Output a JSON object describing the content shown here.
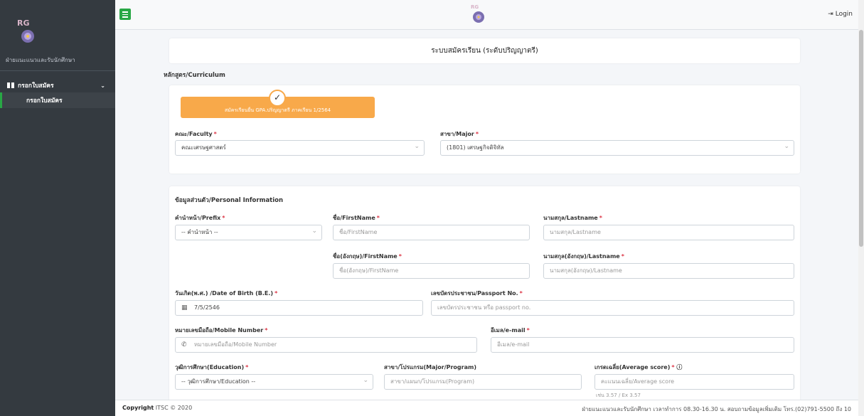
{
  "sidebar": {
    "brand_text": "ฝ่ายแนะแนวและรับนักศึกษา",
    "logo_text": "RG",
    "menu_group": "กรอกใบสมัคร",
    "menu_item": "กรอกใบสมัคร"
  },
  "topbar": {
    "login_label": "Login",
    "logo_text": "RG"
  },
  "page": {
    "title": "ระบบสมัครเรียน (ระดับปริญญาตรี)"
  },
  "curriculum": {
    "section_label": "หลักสูตร/Curriculum",
    "round_badge": "สมัครเรียนยื่น GPA.ปริญญาตรี ภาคเรียน 1/2564",
    "faculty_label": "คณะ/Faculty",
    "faculty_value": "คณะเศรษฐศาสตร์",
    "major_label": "สาขา/Major",
    "major_value": "(1801) เศรษฐกิจดิจิทัล"
  },
  "personal": {
    "section_label": "ข้อมูลส่วนตัว/Personal Information",
    "prefix_label": "คำนำหน้า/Prefix",
    "prefix_value": "-- คำนำหน้า --",
    "firstname_label": "ชื่อ/FirstName",
    "firstname_placeholder": "ชื่อ/FirstName",
    "lastname_label": "นามสกุล/Lastname",
    "lastname_placeholder": "นามสกุล/Lastname",
    "firstname_en_label": "ชื่อ(อังกฤษ)/FirstName",
    "firstname_en_placeholder": "ชื่อ(อังกฤษ)/FirstName",
    "lastname_en_label": "นามสกุล(อังกฤษ)/Lastname",
    "lastname_en_placeholder": "นามสกุล(อังกฤษ)/Lastname",
    "dob_label": "วันเกิด(พ.ศ.) /Date of Birth (B.E.)",
    "dob_value": "7/5/2546",
    "id_label": "เลขบัตรประชาชน/Passport No.",
    "id_placeholder": "เลขบัตรประชาชน หรือ passport no.",
    "mobile_label": "หมายเลขมือถือ/Mobile Number",
    "mobile_placeholder": "หมายเลขมือถือ/Mobile Number",
    "email_label": "อีเมล/e-mail",
    "email_placeholder": "อีเมล/e-mail",
    "education_label": "วุฒิการศึกษา(Education)",
    "education_value": "-- วุฒิการศึกษา/Education --",
    "program_label": "สาขา/โปรแกรม(Major/Program)",
    "program_placeholder": "สาขา/แผนก/โปรแกรม(Program)",
    "gpa_label": "เกรดเฉลี่ย(Average score)",
    "gpa_placeholder": "คะแนนเฉลี่ย/Average score",
    "gpa_hint": "เช่น 3.57 / Ex 3.57"
  },
  "footer": {
    "copyright_bold": "Copyright",
    "copyright_rest": "ITSC © 2020",
    "contact": "ฝ่ายแนะแนวและรับนักศึกษา เวลาทำการ 08.30-16.30 น. สอบถามข้อมูลเพิ่มเติม โทร.(02)791-5500 ถึง 10"
  },
  "colors": {
    "sidebar": "#343a40",
    "accent": "#28a745",
    "badge": "#f8a94a",
    "required": "#dc3545"
  }
}
